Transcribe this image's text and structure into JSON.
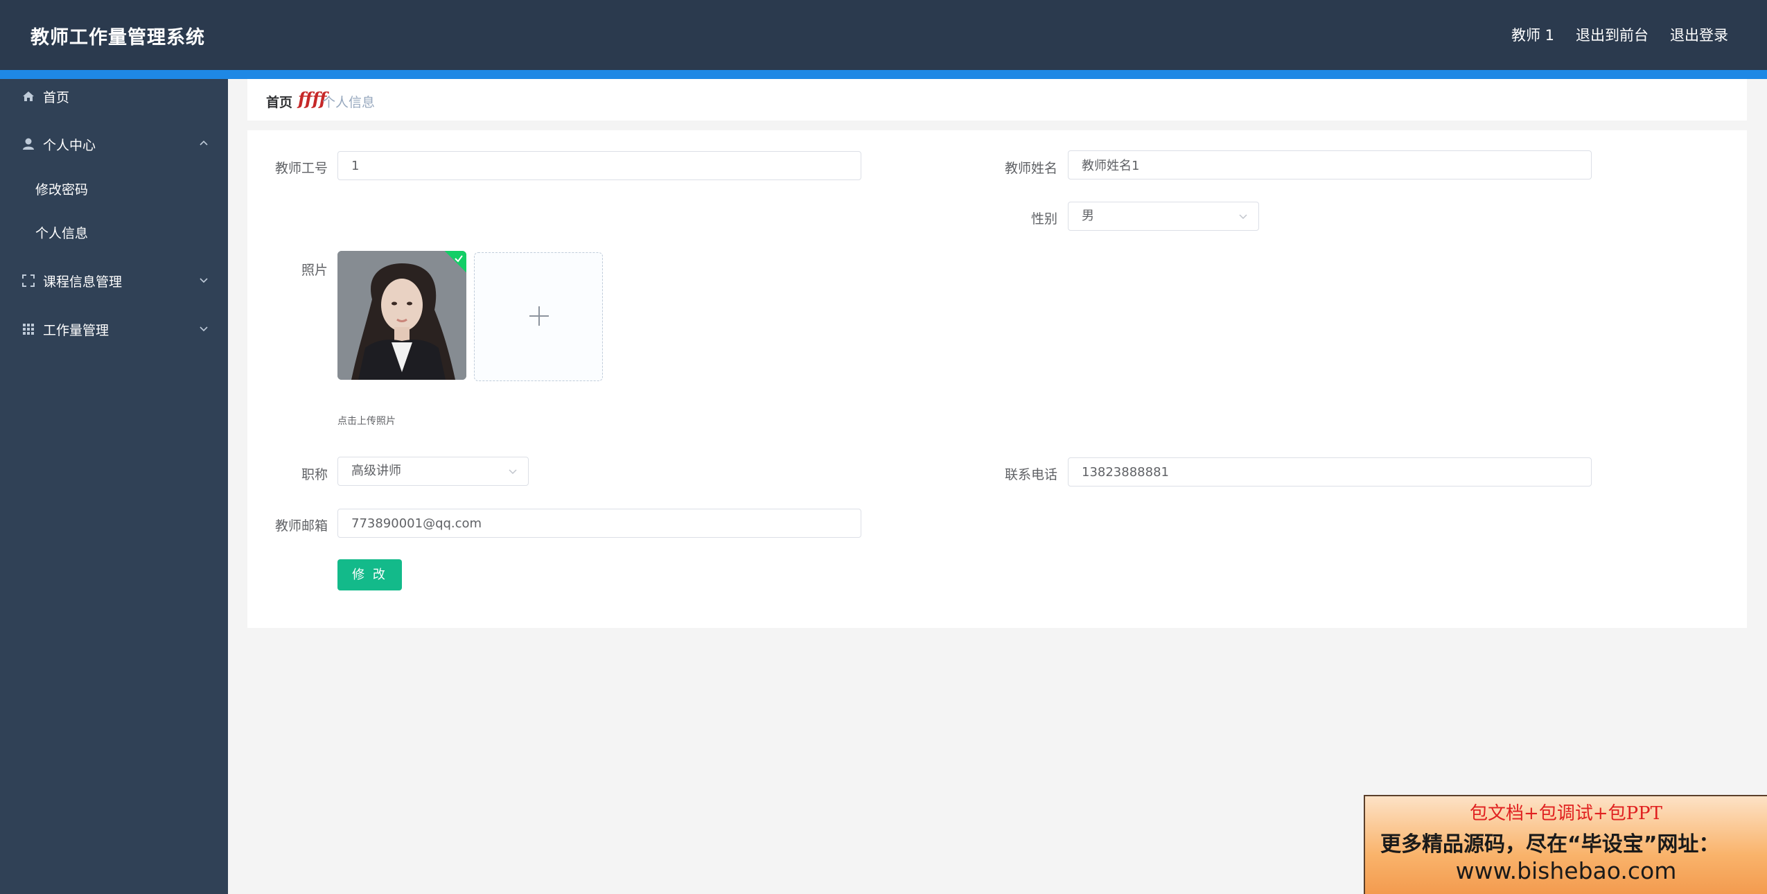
{
  "header": {
    "title": "教师工作量管理系统",
    "user": "教师 1",
    "to_frontend": "退出到前台",
    "logout": "退出登录"
  },
  "sidebar": {
    "items": [
      {
        "label": "首页",
        "icon": "home-icon"
      },
      {
        "label": "个人中心",
        "icon": "user-icon",
        "expanded": true,
        "children": [
          {
            "label": "修改密码"
          },
          {
            "label": "个人信息"
          }
        ]
      },
      {
        "label": "课程信息管理",
        "icon": "fullscreen-icon",
        "expanded": false
      },
      {
        "label": "工作量管理",
        "icon": "grid-icon",
        "expanded": false
      }
    ]
  },
  "breadcrumb": {
    "home": "首页",
    "separator": "ffff",
    "current": "个人信息"
  },
  "form": {
    "teacher_id": {
      "label": "教师工号",
      "value": "1"
    },
    "teacher_name": {
      "label": "教师姓名",
      "value": "教师姓名1"
    },
    "gender": {
      "label": "性别",
      "value": "男"
    },
    "photo": {
      "label": "照片",
      "hint": "点击上传照片"
    },
    "title": {
      "label": "职称",
      "value": "高级讲师"
    },
    "phone": {
      "label": "联系电话",
      "value": "13823888881"
    },
    "email": {
      "label": "教师邮箱",
      "value": "773890001@qq.com"
    },
    "submit": "修 改"
  },
  "ad": {
    "line1": "包文档+包调试+包PPT",
    "line2": "更多精品源码，尽在“毕设宝”网址：",
    "line3": "www.bishebao.com"
  },
  "colors": {
    "header_bg": "#2b3a4e",
    "accent": "#1e88e5",
    "sidebar_bg": "#304156",
    "button": "#13ba8a"
  }
}
